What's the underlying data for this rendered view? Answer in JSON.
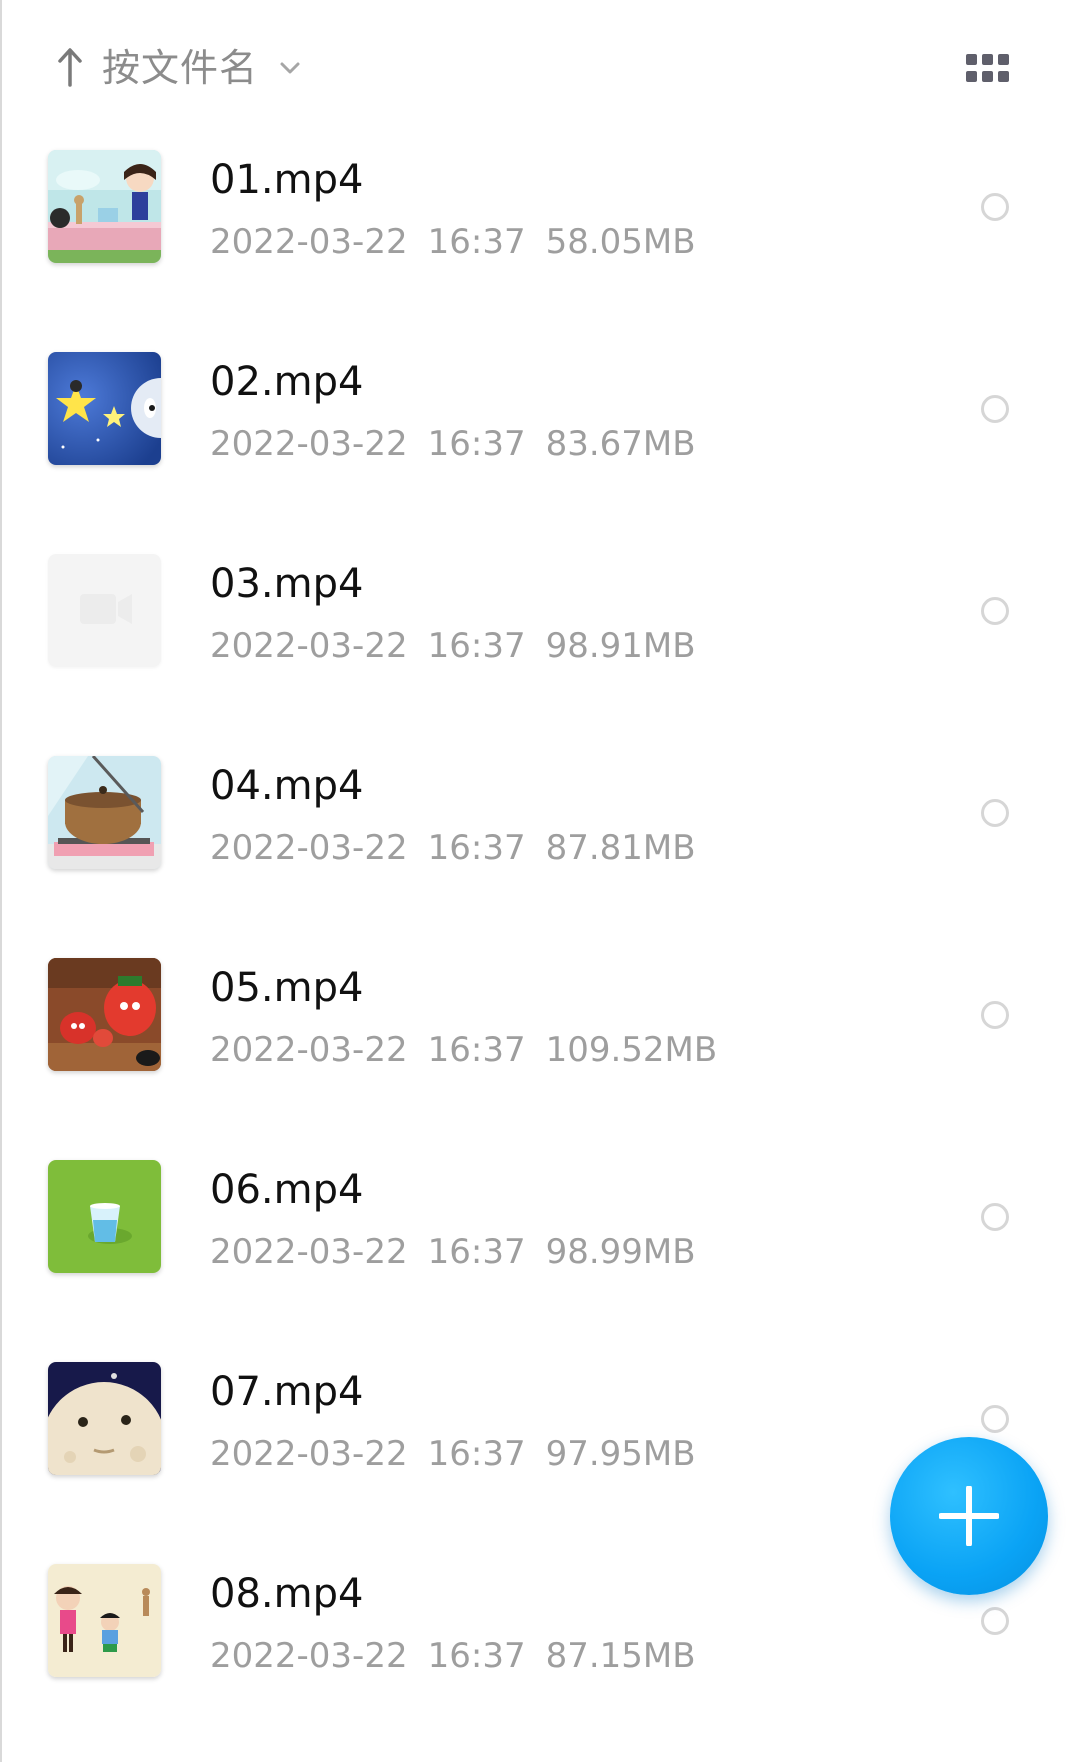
{
  "sort": {
    "label": "按文件名",
    "arrow_icon": "sort-ascending-arrow-icon",
    "dropdown_icon": "chevron-down-icon"
  },
  "view_toggle_icon": "grid-view-icon",
  "files": [
    {
      "name": "01.mp4",
      "date": "2022-03-22",
      "time": "16:37",
      "size": "58.05MB",
      "thumbnail": "cartoon-girl-table-thumbnail"
    },
    {
      "name": "02.mp4",
      "date": "2022-03-22",
      "time": "16:37",
      "size": "83.67MB",
      "thumbnail": "night-sky-stars-thumbnail"
    },
    {
      "name": "03.mp4",
      "date": "2022-03-22",
      "time": "16:37",
      "size": "98.91MB",
      "thumbnail": "video-placeholder-thumbnail"
    },
    {
      "name": "04.mp4",
      "date": "2022-03-22",
      "time": "16:37",
      "size": "87.81MB",
      "thumbnail": "pot-on-stove-thumbnail"
    },
    {
      "name": "05.mp4",
      "date": "2022-03-22",
      "time": "16:37",
      "size": "109.52MB",
      "thumbnail": "red-characters-thumbnail"
    },
    {
      "name": "06.mp4",
      "date": "2022-03-22",
      "time": "16:37",
      "size": "98.99MB",
      "thumbnail": "green-glass-thumbnail"
    },
    {
      "name": "07.mp4",
      "date": "2022-03-22",
      "time": "16:37",
      "size": "97.95MB",
      "thumbnail": "moon-face-thumbnail"
    },
    {
      "name": "08.mp4",
      "date": "2022-03-22",
      "time": "16:37",
      "size": "87.15MB",
      "thumbnail": "kids-cartoon-thumbnail"
    }
  ],
  "fab": {
    "icon": "plus-icon"
  },
  "colors": {
    "accent": "#0aa3f5",
    "secondary_text": "#9e9e9e",
    "primary_text": "#111111"
  }
}
